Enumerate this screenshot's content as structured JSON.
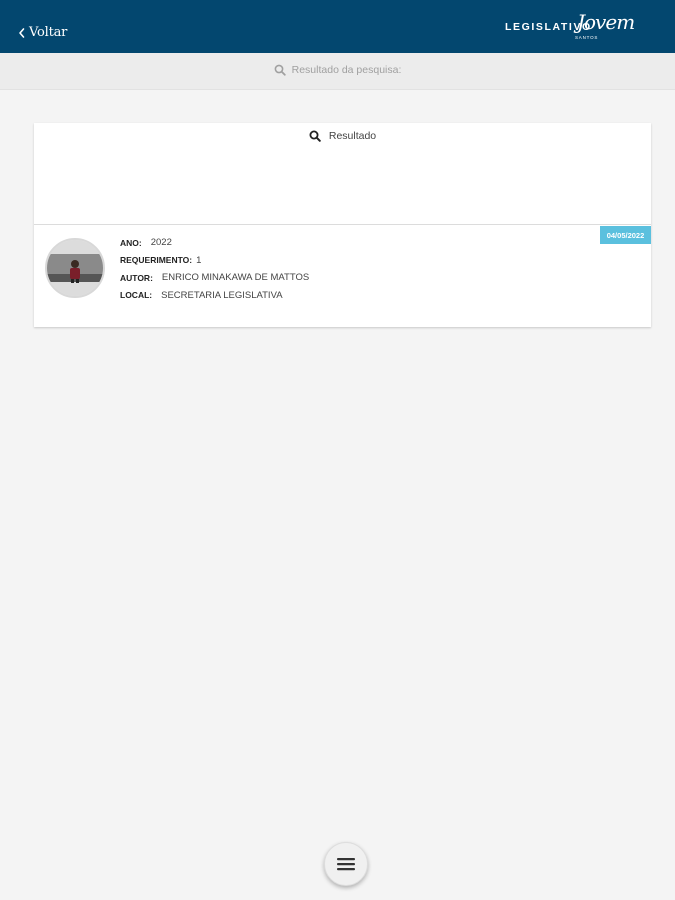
{
  "header": {
    "back_label": "Voltar",
    "brand": {
      "word": "LEGISLATIVO",
      "script": "Jovem",
      "city": "SANTOS"
    },
    "background_color": "#03476f"
  },
  "search": {
    "label": "Resultado da pesquisa:",
    "icon": "search-icon"
  },
  "results_panel": {
    "title": "Resultado",
    "icon": "search-icon"
  },
  "results": [
    {
      "date": "04/05/2022",
      "fields": [
        {
          "key": "ANO:",
          "value": "2022"
        },
        {
          "key": "REQUERIMENTO:",
          "value": "1"
        },
        {
          "key": "AUTOR:",
          "value": "ENRICO MINAKAWA DE MATTOS"
        },
        {
          "key": "LOCAL:",
          "value": "SECRETARIA LEGISLATIVA"
        }
      ],
      "badge_color": "#5bc0de"
    }
  ],
  "menu_button": {
    "icon": "hamburger-menu-icon"
  }
}
